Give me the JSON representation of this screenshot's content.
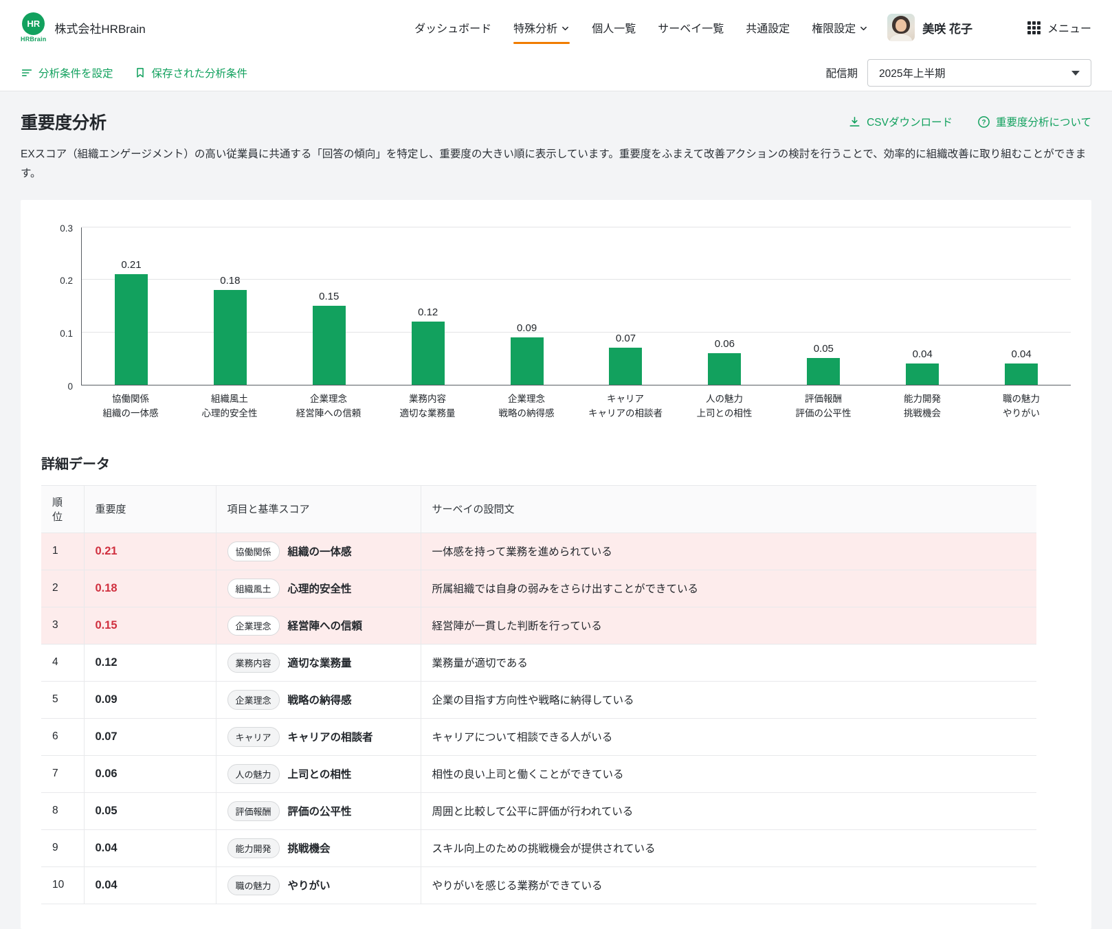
{
  "colors": {
    "green": "#12A15E",
    "orange": "#F07C00",
    "red": "#D0303F",
    "pink": "#FDECEC"
  },
  "header": {
    "logo_text": "HR",
    "logo_sub": "HRBrain",
    "company": "株式会社HRBrain",
    "nav": [
      {
        "id": "dashboard",
        "label": "ダッシュボード",
        "active": false,
        "dropdown": false
      },
      {
        "id": "special-analysis",
        "label": "特殊分析",
        "active": true,
        "dropdown": true
      },
      {
        "id": "personal-list",
        "label": "個人一覧",
        "active": false,
        "dropdown": false
      },
      {
        "id": "survey-list",
        "label": "サーベイ一覧",
        "active": false,
        "dropdown": false
      },
      {
        "id": "common-settings",
        "label": "共通設定",
        "active": false,
        "dropdown": false
      },
      {
        "id": "permission-settings",
        "label": "権限設定",
        "active": false,
        "dropdown": true
      }
    ],
    "user_name": "美咲 花子",
    "menu_label": "メニュー"
  },
  "toolbar": {
    "set_conditions": "分析条件を設定",
    "saved_conditions": "保存された分析条件",
    "period_label": "配信期",
    "period_value": "2025年上半期"
  },
  "page": {
    "title": "重要度分析",
    "csv_download": "CSVダウンロード",
    "about_link": "重要度分析について",
    "description": "EXスコア（組織エンゲージメント）の高い従業員に共通する「回答の傾向」を特定し、重要度の大きい順に表示しています。重要度をふまえて改善アクションの検討を行うことで、効率的に組織改善に取り組むことができます。"
  },
  "chart_data": {
    "type": "bar",
    "categories": [
      [
        "協働関係",
        "組織の一体感"
      ],
      [
        "組織風土",
        "心理的安全性"
      ],
      [
        "企業理念",
        "経営陣への信頼"
      ],
      [
        "業務内容",
        "適切な業務量"
      ],
      [
        "企業理念",
        "戦略の納得感"
      ],
      [
        "キャリア",
        "キャリアの相談者"
      ],
      [
        "人の魅力",
        "上司との相性"
      ],
      [
        "評価報酬",
        "評価の公平性"
      ],
      [
        "能力開発",
        "挑戦機会"
      ],
      [
        "職の魅力",
        "やりがい"
      ]
    ],
    "values": [
      0.21,
      0.18,
      0.15,
      0.12,
      0.09,
      0.07,
      0.06,
      0.05,
      0.04,
      0.04
    ],
    "title": "重要度分析",
    "xlabel": "",
    "ylabel": "",
    "ylim": [
      0,
      0.3
    ],
    "yticks": [
      0,
      0.1,
      0.2,
      0.3
    ],
    "grid": true,
    "legend": false,
    "bar_color": "#12A15E"
  },
  "table": {
    "title": "詳細データ",
    "headers": [
      "順位",
      "重要度",
      "項目と基準スコア",
      "サーベイの設問文"
    ],
    "rows": [
      {
        "rank": "1",
        "importance": "0.21",
        "category": "協働関係",
        "item": "組織の一体感",
        "question": "一体感を持って業務を進められている",
        "highlight": true
      },
      {
        "rank": "2",
        "importance": "0.18",
        "category": "組織風土",
        "item": "心理的安全性",
        "question": "所属組織では自身の弱みをさらけ出すことができている",
        "highlight": true
      },
      {
        "rank": "3",
        "importance": "0.15",
        "category": "企業理念",
        "item": "経営陣への信頼",
        "question": "経営陣が一貫した判断を行っている",
        "highlight": true
      },
      {
        "rank": "4",
        "importance": "0.12",
        "category": "業務内容",
        "item": "適切な業務量",
        "question": "業務量が適切である",
        "highlight": false
      },
      {
        "rank": "5",
        "importance": "0.09",
        "category": "企業理念",
        "item": "戦略の納得感",
        "question": "企業の目指す方向性や戦略に納得している",
        "highlight": false
      },
      {
        "rank": "6",
        "importance": "0.07",
        "category": "キャリア",
        "item": "キャリアの相談者",
        "question": "キャリアについて相談できる人がいる",
        "highlight": false
      },
      {
        "rank": "7",
        "importance": "0.06",
        "category": "人の魅力",
        "item": "上司との相性",
        "question": "相性の良い上司と働くことができている",
        "highlight": false
      },
      {
        "rank": "8",
        "importance": "0.05",
        "category": "評価報酬",
        "item": "評価の公平性",
        "question": "周囲と比較して公平に評価が行われている",
        "highlight": false
      },
      {
        "rank": "9",
        "importance": "0.04",
        "category": "能力開発",
        "item": "挑戦機会",
        "question": "スキル向上のための挑戦機会が提供されている",
        "highlight": false
      },
      {
        "rank": "10",
        "importance": "0.04",
        "category": "職の魅力",
        "item": "やりがい",
        "question": "やりがいを感じる業務ができている",
        "highlight": false
      }
    ]
  }
}
